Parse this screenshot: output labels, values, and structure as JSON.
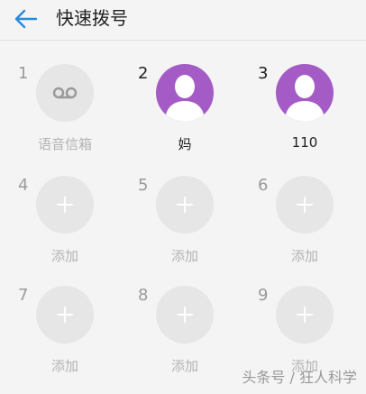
{
  "header": {
    "title": "快速拨号",
    "back_icon": "arrow-left-icon",
    "accent": "#2b8ad9"
  },
  "slots": [
    {
      "number": "1",
      "label": "语音信箱",
      "type": "voicemail",
      "icon": "voicemail-icon"
    },
    {
      "number": "2",
      "label": "妈",
      "type": "contact",
      "icon": "person-avatar-icon"
    },
    {
      "number": "3",
      "label": "110",
      "type": "contact",
      "icon": "person-avatar-icon"
    },
    {
      "number": "4",
      "label": "添加",
      "type": "add",
      "icon": "plus-icon"
    },
    {
      "number": "5",
      "label": "添加",
      "type": "add",
      "icon": "plus-icon"
    },
    {
      "number": "6",
      "label": "添加",
      "type": "add",
      "icon": "plus-icon"
    },
    {
      "number": "7",
      "label": "添加",
      "type": "add",
      "icon": "plus-icon"
    },
    {
      "number": "8",
      "label": "添加",
      "type": "add",
      "icon": "plus-icon"
    },
    {
      "number": "9",
      "label": "添加",
      "type": "add",
      "icon": "plus-icon"
    }
  ],
  "colors": {
    "avatar_bg": "#a45bc6",
    "empty_bg": "#e6e6e6"
  },
  "watermark": "头条号 / 狂人科学"
}
